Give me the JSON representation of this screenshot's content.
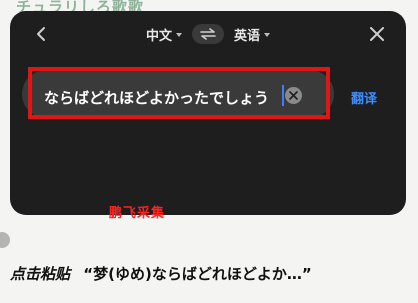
{
  "background_header": "チュラリしろ歌歌",
  "toolbar": {
    "back_icon": "chevron-left-icon",
    "close_icon": "close-icon"
  },
  "languages": {
    "source": "中文",
    "target": "英语",
    "swap_icon": "swap-arrows-icon"
  },
  "input": {
    "value": "ならばどれほどよかったでしょう",
    "clear_icon": "clear-icon"
  },
  "translate_label": "翻译",
  "watermark": "鹏飞采集",
  "caption": {
    "action": "点击粘贴",
    "quote": "“梦(ゆめ)ならばどれほどよか…”"
  },
  "colors": {
    "panel_bg": "#1e1e1e",
    "accent_blue": "#3d8bff",
    "highlight_red": "#e01515"
  }
}
